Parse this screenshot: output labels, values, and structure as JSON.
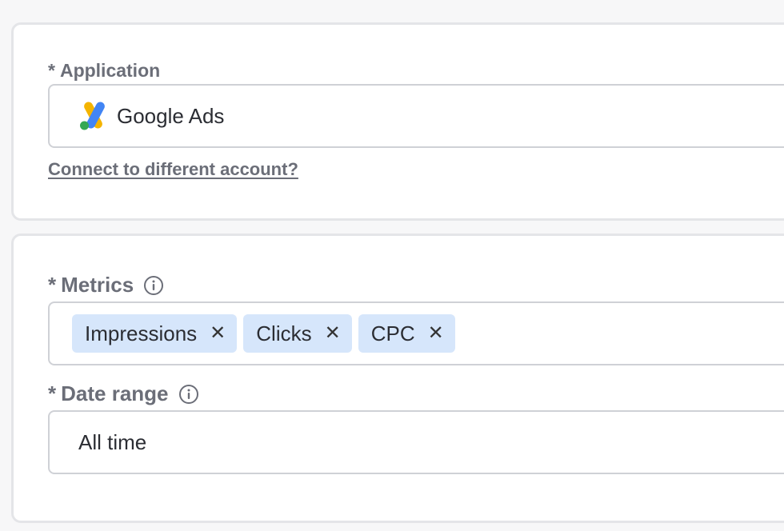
{
  "application_section": {
    "label_required": "*",
    "label": "Application",
    "value": "Google Ads",
    "logo_icon": "google-ads-logo",
    "connect_link": "Connect to different account?"
  },
  "metrics_section": {
    "metrics_field": {
      "label_required": "*",
      "label": "Metrics",
      "info_icon": "info-icon",
      "tags": [
        {
          "label": "Impressions",
          "remove": "✕"
        },
        {
          "label": "Clicks",
          "remove": "✕"
        },
        {
          "label": "CPC",
          "remove": "✕"
        }
      ]
    },
    "date_range_field": {
      "label_required": "*",
      "label": "Date range",
      "info_icon": "info-icon",
      "value": "All time"
    }
  },
  "colors": {
    "tag_background": "#d6e6fb",
    "label_text": "#6b6e78",
    "border": "#cfd1d6",
    "card_border": "#e4e5e8"
  }
}
